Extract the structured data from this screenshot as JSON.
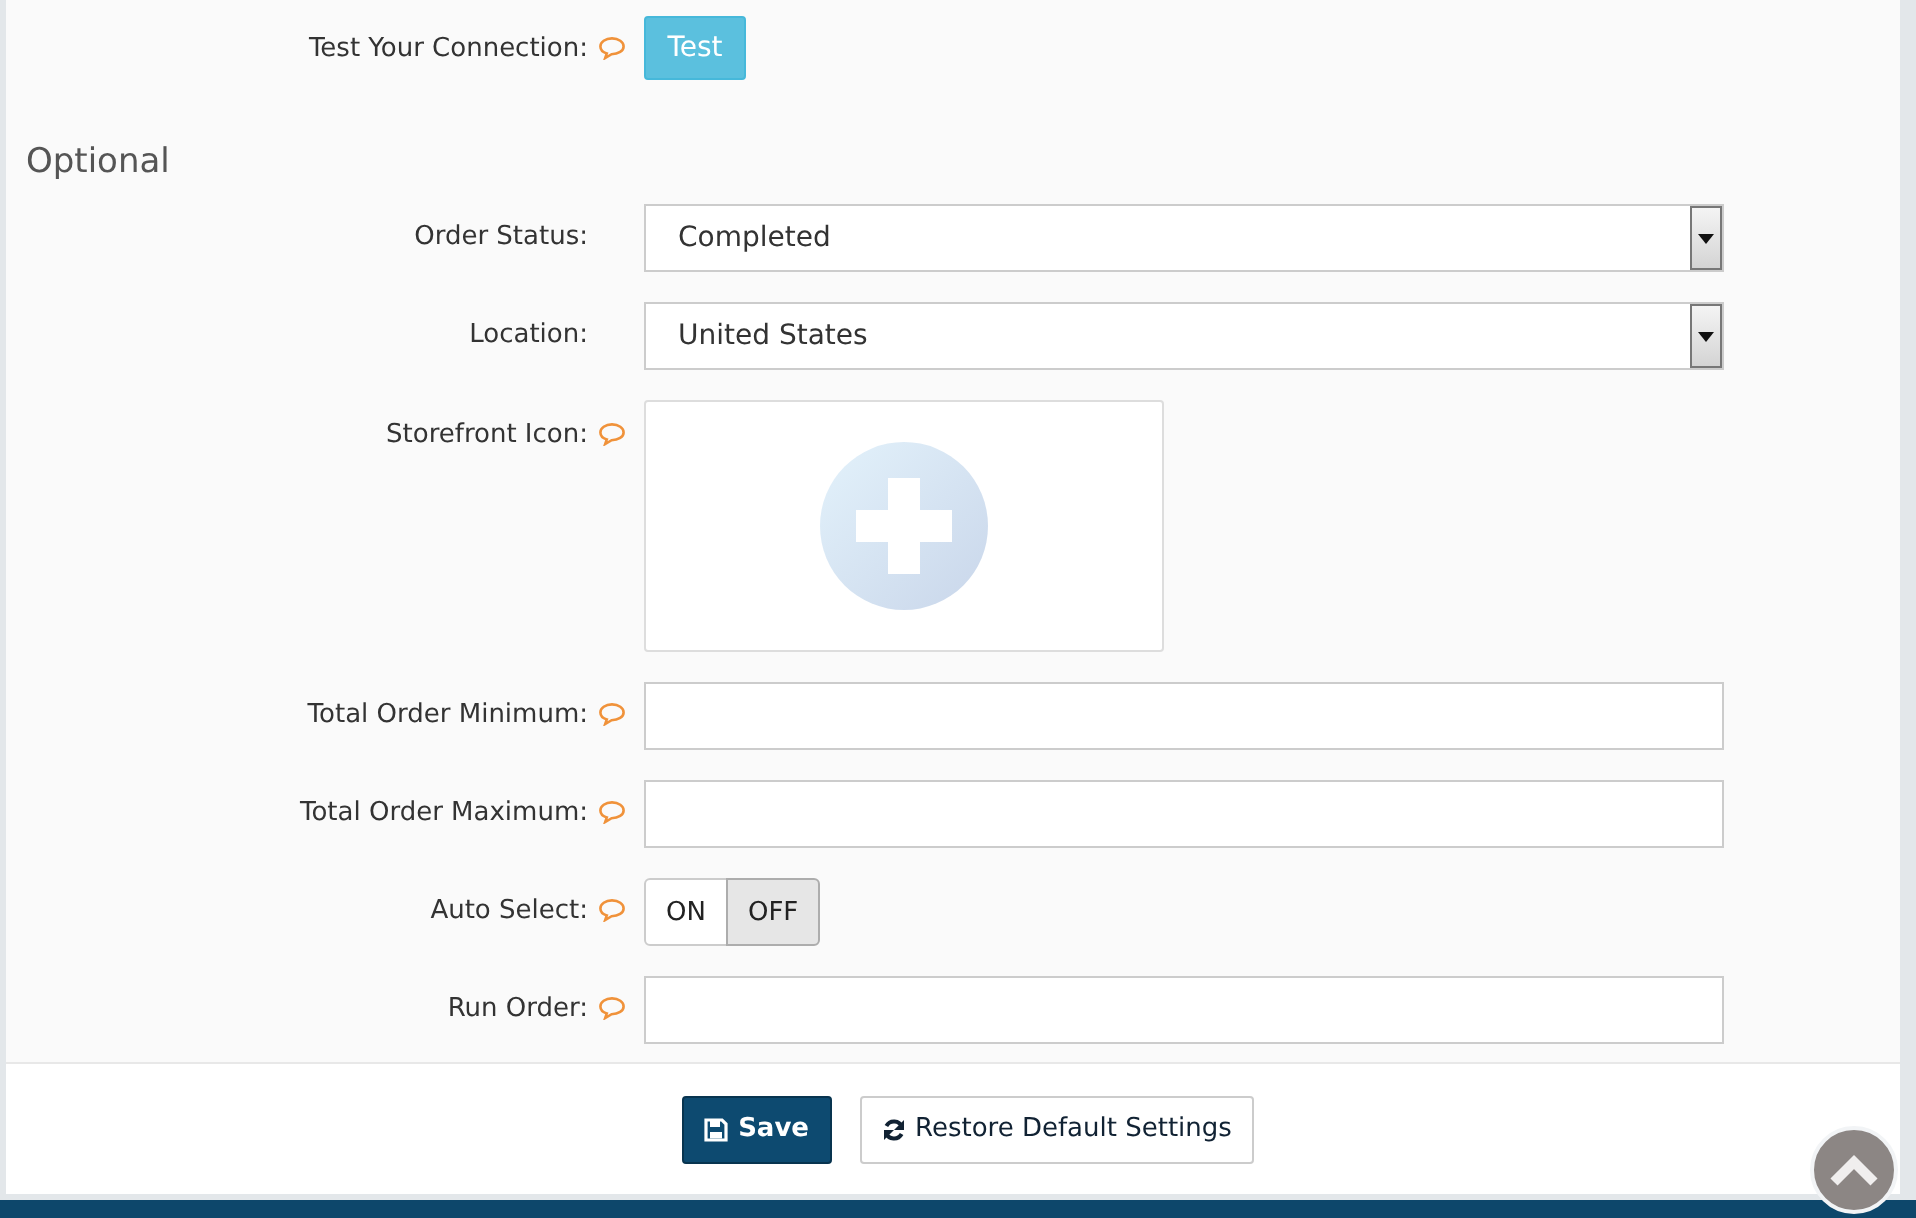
{
  "rows": [
    {
      "kind": "button",
      "label": "Test Your Connection:",
      "help": true,
      "button": "Test"
    },
    {
      "kind": "heading",
      "title": "Optional"
    },
    {
      "kind": "select",
      "label": "Order Status:",
      "help": false,
      "value": "Completed"
    },
    {
      "kind": "select",
      "label": "Location:",
      "help": false,
      "value": "United States"
    },
    {
      "kind": "image",
      "label": "Storefront Icon:",
      "help": true
    },
    {
      "kind": "text",
      "label": "Total Order Minimum:",
      "help": true
    },
    {
      "kind": "text",
      "label": "Total Order Maximum:",
      "help": true
    },
    {
      "kind": "toggle",
      "label": "Auto Select:",
      "help": true,
      "options": [
        {
          "label": "ON",
          "selected": false
        },
        {
          "label": "OFF",
          "selected": true
        }
      ]
    },
    {
      "kind": "text",
      "label": "Run Order:",
      "help": true
    }
  ],
  "footer": {
    "save": "Save",
    "restore": "Restore Default Settings"
  }
}
